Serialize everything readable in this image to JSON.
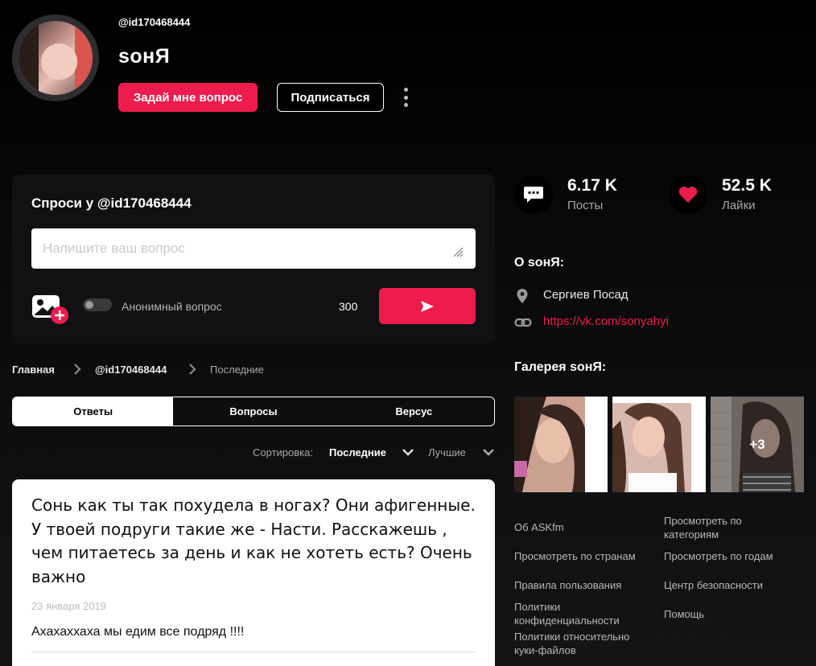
{
  "profile": {
    "username": "@id170468444",
    "display_name": "ѕонЯ",
    "ask_button": "Задай мне вопрос",
    "follow_button": "Подписаться"
  },
  "ask_box": {
    "title": "Спроси у @id170468444",
    "placeholder": "Напишите ваш вопрос",
    "anonymous_label": "Анонимный вопрос",
    "char_count": "300"
  },
  "breadcrumb": {
    "home": "Главная",
    "user": "@id170468444",
    "current": "Последние"
  },
  "tabs": [
    {
      "label": "Ответы"
    },
    {
      "label": "Вопросы"
    },
    {
      "label": "Версус"
    }
  ],
  "sort": {
    "label": "Сортировка:",
    "latest": "Последние",
    "best": "Лучшие"
  },
  "answer": {
    "question": "Сонь как ты так похудела в ногах? Они афигенные. У твоей подруги такие же - Насти. Расскажешь , чем питаетесь за день и как не хотеть есть? Очень важно",
    "date": "23 января 2019",
    "text": "Ахахаххаха мы едим все подряд !!!!"
  },
  "stats": {
    "posts_value": "6.17 K",
    "posts_label": "Посты",
    "likes_value": "52.5 K",
    "likes_label": "Лайки"
  },
  "about": {
    "title": "О ѕонЯ:",
    "location": "Сергиев Посад",
    "link": "https://vk.com/sonyahyi"
  },
  "gallery": {
    "title": "Галерея ѕонЯ:",
    "more": "+3"
  },
  "footer": {
    "col1": [
      "Об ASKfm",
      "Просмотреть по странам",
      "Правила пользования",
      "Политики конфиденциальности",
      "Политики относительно куки-файлов"
    ],
    "col2": [
      "Просмотреть по категориям",
      "Просмотреть по годам",
      "Центр безопасности",
      "Помощь"
    ]
  },
  "colors": {
    "accent": "#ee1c4d",
    "background": "#000000"
  }
}
